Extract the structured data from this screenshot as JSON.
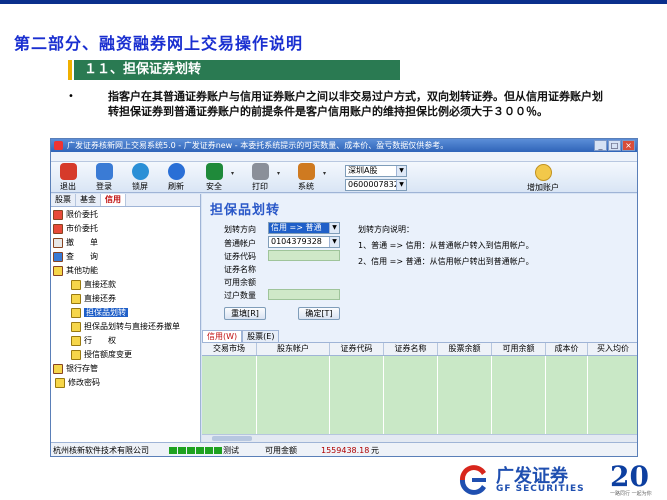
{
  "slide": {
    "title": "第二部分、融资融券网上交易操作说明",
    "section": "１１、担保证券划转",
    "bullet": "•",
    "body": "指客户在其普通证券账户与信用证券账户之间以非交易过户方式，双向划转证券。但从信用证券账户划转担保证券到普通证券账户的前提条件是客户信用账户的维持担保比例必须大于３００％。"
  },
  "window": {
    "title": "广发证券核新网上交易系统5.0 - 广发证券new - 本委托系统提示的可买数量、成本价、盈亏数据仅供参考。",
    "controls": [
      "_",
      "□",
      "×"
    ]
  },
  "toolbar": {
    "buttons": [
      {
        "label": "退出",
        "icon": "exit-icon",
        "color": "#d63a2a"
      },
      {
        "label": "登录",
        "icon": "login-icon",
        "color": "#3a7bd5"
      },
      {
        "label": "锁屏",
        "icon": "lock-screen-icon",
        "color": "#2a8fd6"
      },
      {
        "label": "刷新",
        "icon": "refresh-icon",
        "color": "#2a6fd6"
      },
      {
        "label": "安全",
        "icon": "security-icon",
        "color": "#1f8a3a"
      },
      {
        "label": "打印",
        "icon": "print-icon",
        "color": "#8a8f99"
      },
      {
        "label": "系统",
        "icon": "system-icon",
        "color": "#cf7a20"
      }
    ],
    "arrow": "▾",
    "market": "深圳A股",
    "account": "0600007832",
    "add_account": "增加账户",
    "dropdown_glyph": "▼"
  },
  "left_panel": {
    "tabs": [
      "股票",
      "基金",
      "信用"
    ],
    "active_tab": 2,
    "tree": [
      {
        "label": "限价委托",
        "level": "top"
      },
      {
        "label": "市价委托",
        "level": "top"
      },
      {
        "label": "撤　　单",
        "level": "top"
      },
      {
        "label": "查　　询",
        "level": "top"
      },
      {
        "label": "其他功能",
        "level": "top"
      },
      {
        "label": "直接还款",
        "level": "sub"
      },
      {
        "label": "直接还券",
        "level": "sub"
      },
      {
        "label": "担保品划转",
        "level": "sub",
        "selected": true
      },
      {
        "label": "担保品划转与直接还券撤单",
        "level": "sub"
      },
      {
        "label": "行　　权",
        "level": "sub"
      },
      {
        "label": "授信额度变更",
        "level": "sub"
      },
      {
        "label": "银行存管",
        "level": "top"
      },
      {
        "label": "修改密码",
        "level": "sub"
      }
    ]
  },
  "form": {
    "title": "担保品划转",
    "direction_label": "划转方向",
    "direction_value": "信用 => 普通",
    "account_label": "普通帐户",
    "account_value": "0104379328",
    "code_label": "证券代码",
    "name_label": "证券名称",
    "available_label": "可用余额",
    "quantity_label": "过户数量",
    "reset_button": "重填[R]",
    "confirm_button": "确定[T]",
    "explain_title": "划转方向说明：",
    "explain_1": "1、普通 => 信用：从普通帐户转入到信用帐户。",
    "explain_2": "2、信用 => 普通：从信用帐户转出到普通帐户。"
  },
  "bottom": {
    "tabs": [
      "信用(W)",
      "股票(E)"
    ],
    "columns": [
      "交易市场",
      "股东帐户",
      "证券代码",
      "证券名称",
      "股票余额",
      "可用余额",
      "成本价",
      "买入均价"
    ]
  },
  "status": {
    "company": "杭州核新软件技术有限公司",
    "progress_segments": 6,
    "mode": "测试",
    "balance_label": "可用金额",
    "balance_value": "1559438.18",
    "currency": "元"
  },
  "logo": {
    "name": "广发证券",
    "english": "GF SECURITIES",
    "number": "20",
    "slogan": "一路同行  一起为你"
  }
}
